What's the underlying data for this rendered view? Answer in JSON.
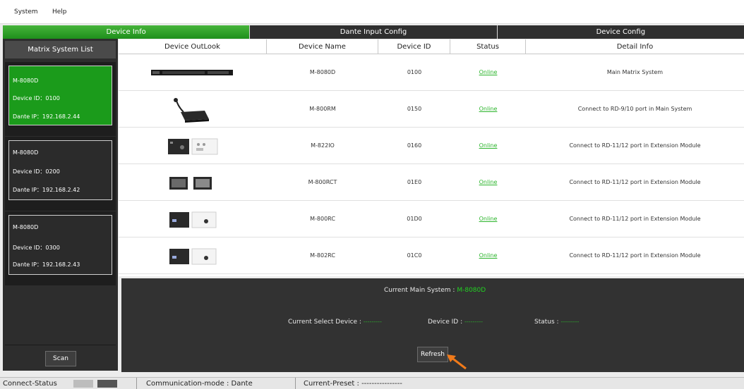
{
  "menu": {
    "items": [
      "System",
      "Help"
    ]
  },
  "tabs": [
    {
      "label": "Device Info",
      "active": true
    },
    {
      "label": "Dante Input Config",
      "active": false
    },
    {
      "label": "Device Config",
      "active": false
    }
  ],
  "left_panel": {
    "title": "Matrix System List",
    "systems": [
      {
        "name": "M-8080D",
        "device_id": "Device ID：0100",
        "dante_ip": "Dante IP：192.168.2.44",
        "active": true
      },
      {
        "name": "M-8080D",
        "device_id": "Device ID：0200",
        "dante_ip": "Dante IP：192.168.2.42",
        "active": false
      },
      {
        "name": "M-8080D",
        "device_id": "Device ID：0300",
        "dante_ip": "Dante IP：192.168.2.43",
        "active": false
      }
    ],
    "scan_label": "Scan"
  },
  "table": {
    "headers": [
      "Device OutLook",
      "Device Name",
      "Device ID",
      "Status",
      "Detail Info"
    ],
    "rows": [
      {
        "name": "M-8080D",
        "id": "0100",
        "status": "Online",
        "detail": "Main Matrix System",
        "icon": "rack-unit-icon"
      },
      {
        "name": "M-800RM",
        "id": "0150",
        "status": "Online",
        "detail": "Connect to RD-9/10 port in Main System",
        "icon": "paging-mic-icon"
      },
      {
        "name": "M-822IO",
        "id": "0160",
        "status": "Online",
        "detail": "Connect to RD-11/12 port in Extension Module",
        "icon": "wall-panel-io-icon"
      },
      {
        "name": "M-800RCT",
        "id": "01E0",
        "status": "Online",
        "detail": "Connect to RD-11/12 port in Extension Module",
        "icon": "touch-panel-icon"
      },
      {
        "name": "M-800RC",
        "id": "01D0",
        "status": "Online",
        "detail": "Connect to RD-11/12 port in Extension Module",
        "icon": "wall-controller-icon"
      },
      {
        "name": "M-802RC",
        "id": "01C0",
        "status": "Online",
        "detail": "Connect to RD-11/12 port in Extension Module",
        "icon": "wall-controller-icon"
      }
    ]
  },
  "bottom": {
    "main_system_label": "Current Main System :",
    "main_system_value": "M-8080D",
    "select_device_label": "Current Select Device :",
    "select_device_value": "---------",
    "device_id_label": "Device ID :",
    "device_id_value": "---------",
    "status_label": "Status :",
    "status_value": "---------",
    "refresh_label": "Refresh"
  },
  "statusbar": {
    "connect_label": "Connect-Status",
    "mode_label": "Communication-mode : Dante",
    "preset_label": "Current-Preset : ----------------"
  },
  "colors": {
    "accent_green": "#1f8f1c",
    "online_green": "#2db52d",
    "arrow_orange": "#f07a1a"
  }
}
